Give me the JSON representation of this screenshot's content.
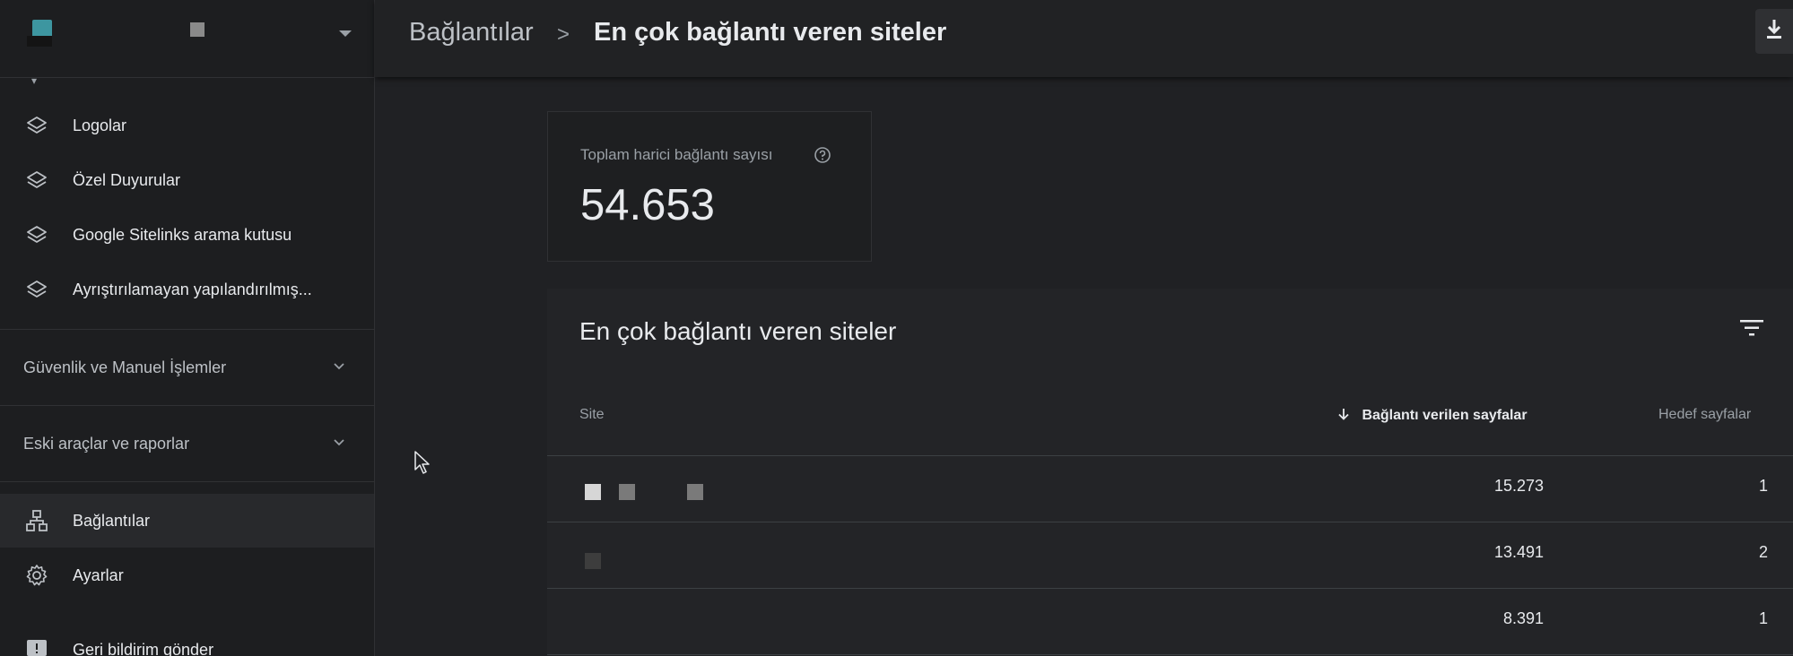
{
  "sidebar": {
    "items": [
      {
        "label": "Logolar",
        "icon": "layers-icon"
      },
      {
        "label": "Özel Duyurular",
        "icon": "layers-icon"
      },
      {
        "label": "Google Sitelinks arama kutusu",
        "icon": "layers-icon"
      },
      {
        "label": "Ayrıştırılamayan yapılandırılmış...",
        "icon": "layers-icon"
      }
    ],
    "sections": [
      {
        "label": "Güvenlik ve Manuel İşlemler"
      },
      {
        "label": "Eski araçlar ve raporlar"
      }
    ],
    "bottom_items": [
      {
        "label": "Bağlantılar",
        "icon": "links-icon",
        "active": true
      },
      {
        "label": "Ayarlar",
        "icon": "gear-icon"
      },
      {
        "label": "Geri bildirim gönder",
        "icon": "feedback-icon"
      }
    ]
  },
  "header": {
    "breadcrumb_parent": "Bağlantılar",
    "breadcrumb_separator": ">",
    "breadcrumb_current": "En çok bağlantı veren siteler"
  },
  "total_card": {
    "label": "Toplam harici bağlantı sayısı",
    "value": "54.653"
  },
  "table": {
    "title": "En çok bağlantı veren siteler",
    "columns": [
      "Site",
      "Bağlantı verilen sayfalar",
      "Hedef sayfalar"
    ],
    "rows": [
      {
        "linking_pages": "15.273",
        "target_pages": "1"
      },
      {
        "linking_pages": "13.491",
        "target_pages": "2"
      },
      {
        "linking_pages": "8.391",
        "target_pages": "1"
      }
    ]
  },
  "colors": {
    "background": "#202124",
    "sidebar": "#1d1e20",
    "text": "#e8eaed",
    "muted": "#9aa0a6",
    "accent_logo": "#3d96a0"
  }
}
